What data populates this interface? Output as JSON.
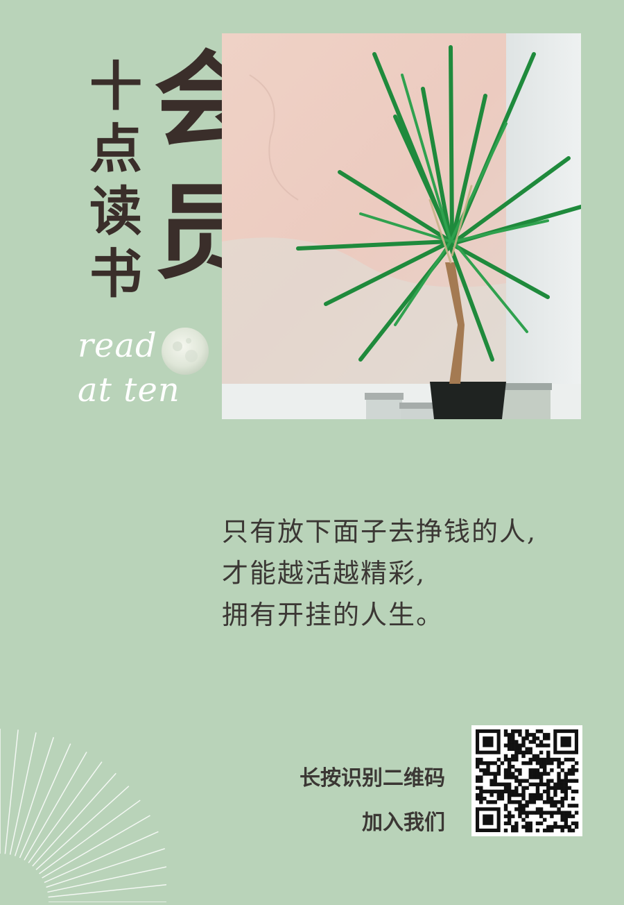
{
  "title": {
    "small": [
      "十",
      "点",
      "读",
      "书"
    ],
    "big": [
      "会",
      "员"
    ]
  },
  "slogan_en": {
    "line1": "read",
    "line2": "at ten"
  },
  "quote": {
    "lines": [
      "只有放下面子去挣钱的人,",
      "才能越活越精彩,",
      "拥有开挂的人生。"
    ]
  },
  "cta": {
    "line1": "长按识别二维码",
    "line2": "加入我们"
  },
  "colors": {
    "background": "#b9d3b9",
    "ink": "#3a2e2a",
    "text": "#3b3734",
    "plant_green": "#1f8a3c",
    "wall_pink": "#ecc9bd"
  },
  "icons": [
    "moon-icon",
    "qr-code",
    "sunburst-rays"
  ]
}
